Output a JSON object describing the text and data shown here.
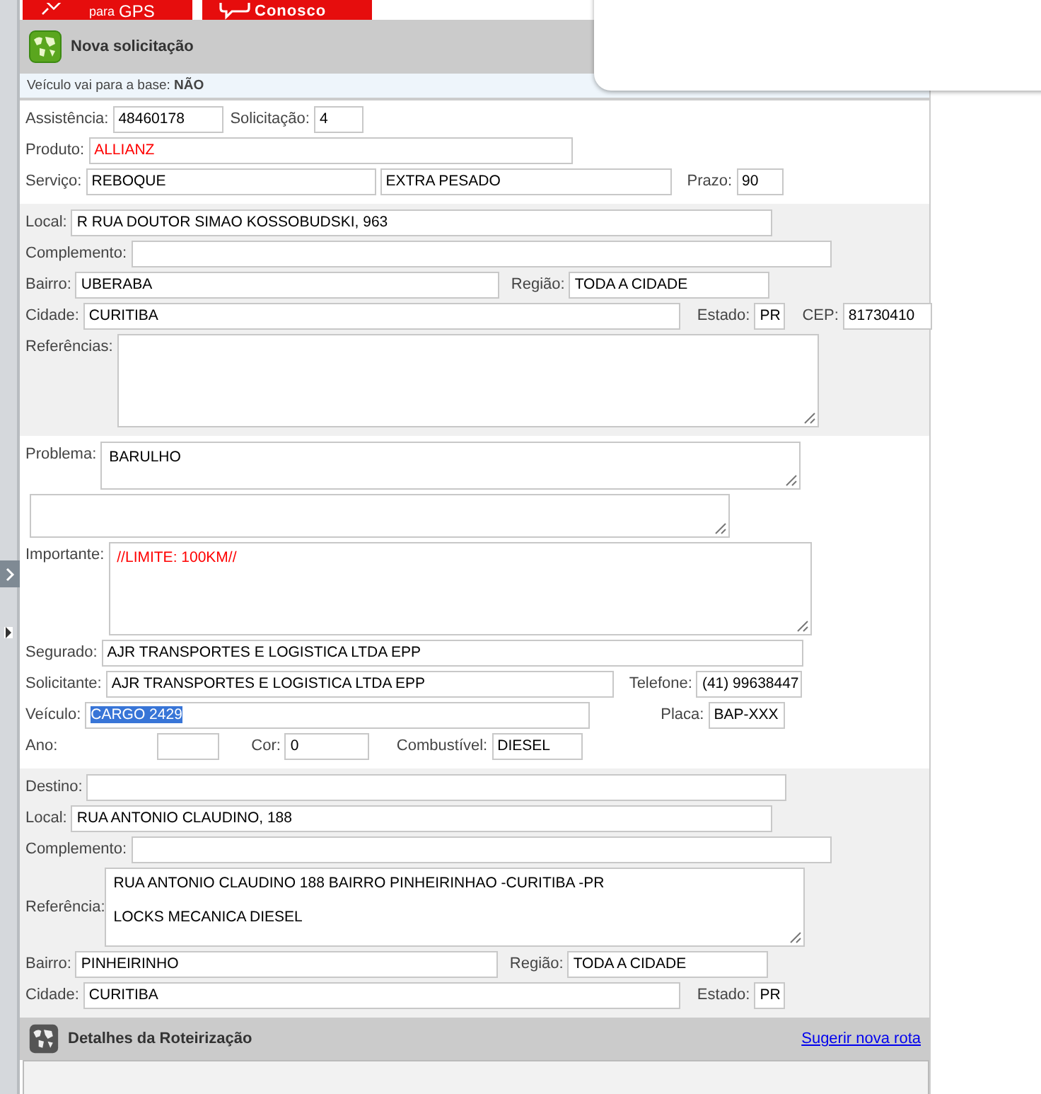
{
  "top_buttons": [
    {
      "kind": "gps",
      "label_small": "para",
      "label": "GPS"
    },
    {
      "kind": "chat",
      "label": "Conosco"
    }
  ],
  "panel_title": "Nova solicitação",
  "base_notice": {
    "label": "Veículo vai para a base:",
    "value": "NÃO"
  },
  "sections": [
    {
      "shaded": false,
      "rows": [
        [
          {
            "kind": "input",
            "label": "Assistência:",
            "value": "48460178"
          },
          {
            "kind": "input",
            "label": "Solicitação:",
            "value": "4"
          }
        ],
        [
          {
            "kind": "input",
            "label": "Produto:",
            "value": "ALLIANZ",
            "alert": true
          }
        ],
        [
          {
            "kind": "input",
            "label": "Serviço:",
            "value": "REBOQUE"
          },
          {
            "kind": "input",
            "value": "EXTRA PESADO"
          },
          {
            "kind": "input",
            "label": "Prazo:",
            "value": "90"
          }
        ]
      ]
    },
    {
      "shaded": true,
      "rows": [
        [
          {
            "kind": "input",
            "label": "Local:",
            "value": "R RUA DOUTOR SIMAO KOSSOBUDSKI, 963"
          }
        ],
        [
          {
            "kind": "input",
            "label": "Complemento:"
          }
        ],
        [
          {
            "kind": "input",
            "label": "Bairro:",
            "value": "UBERABA"
          },
          {
            "kind": "input",
            "label": "Região:",
            "value": "TODA A CIDADE"
          }
        ],
        [
          {
            "kind": "input",
            "label": "Cidade:",
            "value": "CURITIBA"
          },
          {
            "kind": "input",
            "label": "Estado:",
            "value": "PR"
          },
          {
            "kind": "input",
            "label": "CEP:",
            "value": "81730410"
          }
        ],
        [
          {
            "kind": "textarea",
            "label": "Referências:"
          }
        ]
      ]
    },
    {
      "shaded": false,
      "rows": [
        [
          {
            "kind": "textarea",
            "label": "Problema:",
            "value": "BARULHO"
          }
        ],
        [
          {
            "kind": "textarea"
          }
        ],
        [
          {
            "kind": "textarea",
            "label": "Importante:",
            "value": "//LIMITE: 100KM//",
            "alert": true
          }
        ],
        [
          {
            "kind": "input",
            "label": "Segurado:",
            "value": "AJR TRANSPORTES E LOGISTICA LTDA EPP"
          }
        ],
        [
          {
            "kind": "input",
            "label": "Solicitante:",
            "value": "AJR TRANSPORTES E LOGISTICA LTDA EPP"
          },
          {
            "kind": "input",
            "label": "Telefone:",
            "value": "(41) 99638447"
          }
        ],
        [
          {
            "kind": "input",
            "label": "Veículo:",
            "value": "CARGO 2429",
            "highlighted": true
          },
          {
            "kind": "input",
            "label": "Placa:",
            "value": "BAP-XXX"
          }
        ],
        [
          {
            "kind": "input",
            "label": "Ano:"
          },
          {
            "kind": "input",
            "label": "Cor:",
            "value": "0"
          },
          {
            "kind": "input",
            "label": "Combustível:",
            "value": "DIESEL"
          }
        ]
      ]
    },
    {
      "shaded": true,
      "rows": [
        [
          {
            "kind": "input",
            "label": "Destino:"
          }
        ],
        [
          {
            "kind": "input",
            "label": "Local:",
            "value": "RUA ANTONIO CLAUDINO, 188"
          }
        ],
        [
          {
            "kind": "input",
            "label": "Complemento:"
          }
        ],
        [
          {
            "kind": "textarea",
            "label": "Referência:",
            "value": "RUA ANTONIO CLAUDINO 188 BAIRRO PINHEIRINHAO -CURITIBA -PR\n\nLOCKS MECANICA DIESEL"
          }
        ],
        [
          {
            "kind": "input",
            "label": "Bairro:",
            "value": "PINHEIRINHO"
          },
          {
            "kind": "input",
            "label": "Região:",
            "value": "TODA A CIDADE"
          }
        ],
        [
          {
            "kind": "input",
            "label": "Cidade:",
            "value": "CURITIBA"
          },
          {
            "kind": "input",
            "label": "Estado:",
            "value": "PR"
          }
        ]
      ]
    }
  ],
  "route_section": {
    "title": "Detalhes da Roteirização",
    "link": "Sugerir nova rota"
  }
}
